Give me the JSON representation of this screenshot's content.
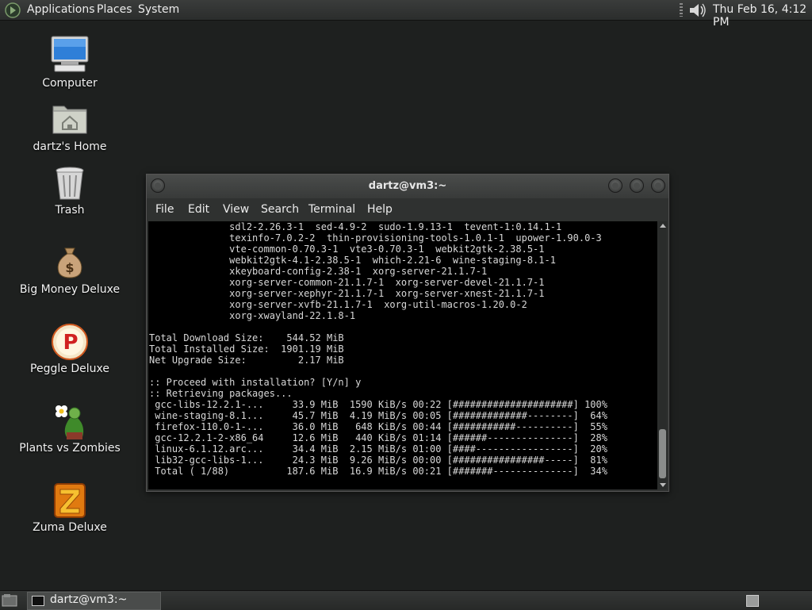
{
  "top_panel": {
    "menus": [
      "Applications",
      "Places",
      "System"
    ],
    "clock": "Thu Feb 16,  4:12 PM",
    "icons": {
      "logo": "gnome-foot-icon",
      "volume": "volume-icon"
    }
  },
  "desktop": {
    "icons": [
      {
        "label": "Computer",
        "icon": "computer-icon"
      },
      {
        "label": "dartz's Home",
        "icon": "home-folder-icon"
      },
      {
        "label": "Trash",
        "icon": "trash-icon"
      },
      {
        "label": "Big Money Deluxe",
        "icon": "money-bag-icon"
      },
      {
        "label": "Peggle Deluxe",
        "icon": "peggle-icon"
      },
      {
        "label": "Plants vs Zombies",
        "icon": "plants-vs-zombies-icon"
      },
      {
        "label": "Zuma Deluxe",
        "icon": "zuma-icon"
      }
    ]
  },
  "terminal": {
    "title": "dartz@vm3:~",
    "menus": [
      "File",
      "Edit",
      "View",
      "Search",
      "Terminal",
      "Help"
    ],
    "lines": [
      "              sdl2-2.26.3-1  sed-4.9-2  sudo-1.9.13-1  tevent-1:0.14.1-1",
      "              texinfo-7.0.2-2  thin-provisioning-tools-1.0.1-1  upower-1.90.0-3",
      "              vte-common-0.70.3-1  vte3-0.70.3-1  webkit2gtk-2.38.5-1",
      "              webkit2gtk-4.1-2.38.5-1  which-2.21-6  wine-staging-8.1-1",
      "              xkeyboard-config-2.38-1  xorg-server-21.1.7-1",
      "              xorg-server-common-21.1.7-1  xorg-server-devel-21.1.7-1",
      "              xorg-server-xephyr-21.1.7-1  xorg-server-xnest-21.1.7-1",
      "              xorg-server-xvfb-21.1.7-1  xorg-util-macros-1.20.0-2",
      "              xorg-xwayland-22.1.8-1",
      "",
      "Total Download Size:    544.52 MiB",
      "Total Installed Size:  1901.19 MiB",
      "Net Upgrade Size:         2.17 MiB",
      "",
      ":: Proceed with installation? [Y/n] y",
      ":: Retrieving packages...",
      " gcc-libs-12.2.1-...     33.9 MiB  1590 KiB/s 00:22 [#####################] 100%",
      " wine-staging-8.1...     45.7 MiB  4.19 MiB/s 00:05 [#############--------]  64%",
      " firefox-110.0-1-...     36.0 MiB   648 KiB/s 00:44 [###########----------]  55%",
      " gcc-12.2.1-2-x86_64     12.6 MiB   440 KiB/s 01:14 [######---------------]  28%",
      " linux-6.1.12.arc...     34.4 MiB  2.15 MiB/s 01:00 [####-----------------]  20%",
      " lib32-gcc-libs-1...     24.3 MiB  9.26 MiB/s 00:00 [################-----]  81%",
      " Total ( 1/88)          187.6 MiB  16.9 MiB/s 00:21 [#######--------------]  34%"
    ]
  },
  "taskbar": {
    "task_label": "dartz@vm3:~",
    "icons": {
      "show_desktop": "show-desktop-icon",
      "task": "terminal-icon",
      "workspace": "workspace-switcher-icon"
    }
  }
}
